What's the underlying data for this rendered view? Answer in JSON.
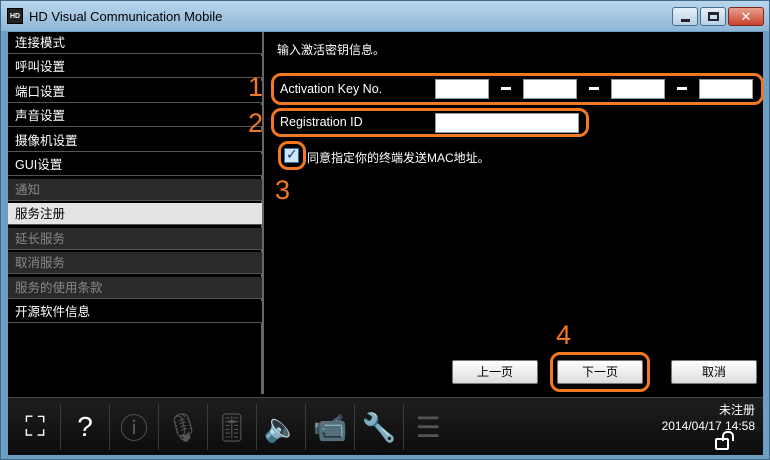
{
  "window": {
    "title": "HD Visual Communication Mobile",
    "app_icon_text": "HD",
    "close_glyph": "✕"
  },
  "sidebar": {
    "items": [
      {
        "label": "连接模式",
        "state": "enabled"
      },
      {
        "label": "呼叫设置",
        "state": "enabled"
      },
      {
        "label": "端口设置",
        "state": "enabled"
      },
      {
        "label": "声音设置",
        "state": "enabled"
      },
      {
        "label": "摄像机设置",
        "state": "enabled"
      },
      {
        "label": "GUI设置",
        "state": "enabled"
      },
      {
        "label": "通知",
        "state": "disabled"
      },
      {
        "label": "服务注册",
        "state": "selected"
      },
      {
        "label": "延长服务",
        "state": "disabled"
      },
      {
        "label": "取消服务",
        "state": "disabled"
      },
      {
        "label": "服务的使用条款",
        "state": "disabled"
      },
      {
        "label": "开源软件信息",
        "state": "enabled"
      }
    ]
  },
  "main": {
    "instruction": "输入激活密钥信息。",
    "activation_label": "Activation Key No.",
    "activation_values": [
      "",
      "",
      "",
      ""
    ],
    "registration_label": "Registration ID",
    "registration_value": "",
    "mac_checkbox_checked": true,
    "mac_checkbox_label": "同意指定你的终端发送MAC地址。",
    "callouts": [
      "1",
      "2",
      "3",
      "4"
    ],
    "buttons": {
      "prev": "上一页",
      "next": "下一页",
      "cancel": "取消"
    }
  },
  "toolbar": {
    "items": [
      {
        "icon": "screen-icon",
        "glyph": "⛶",
        "state": "active"
      },
      {
        "icon": "help-icon",
        "glyph": "?",
        "state": "active"
      },
      {
        "icon": "info-icon",
        "glyph": "ⓘ",
        "state": "inactive"
      },
      {
        "icon": "mic-mute-icon",
        "glyph": "🎙",
        "state": "inactive"
      },
      {
        "icon": "mic-volume-icon",
        "glyph": "🎚",
        "state": "inactive"
      },
      {
        "icon": "speaker-icon",
        "glyph": "🔈",
        "state": "inactive"
      },
      {
        "icon": "camera-mute-icon",
        "glyph": "📹",
        "state": "inactive"
      },
      {
        "icon": "wrench-icon",
        "glyph": "🔧",
        "state": "inactive"
      },
      {
        "icon": "menu-icon",
        "glyph": "☰",
        "state": "inactive"
      }
    ],
    "status_text": "未注册",
    "datetime": "2014/04/17 14:58"
  },
  "colors": {
    "highlight": "#f07820",
    "titlebar": "#8fb6d6",
    "selected_item": "#e4e4e4"
  }
}
